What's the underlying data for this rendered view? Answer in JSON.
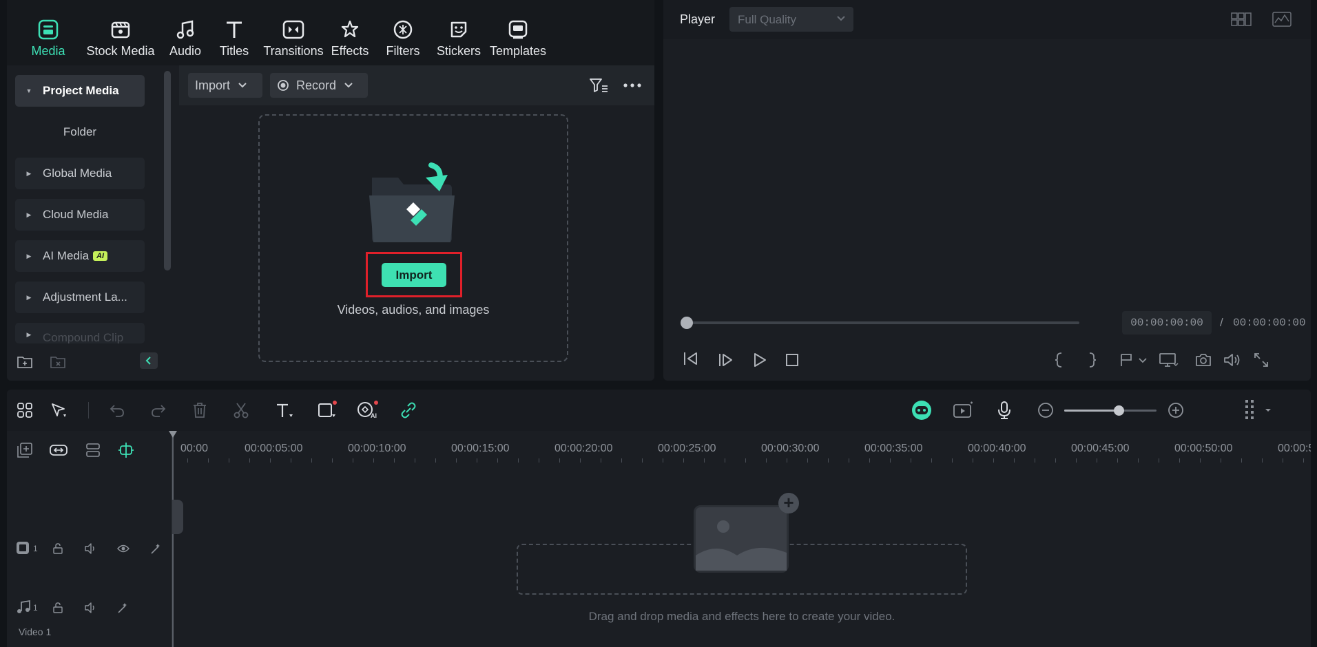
{
  "nav": {
    "items": [
      {
        "label": "Media",
        "icon": "media-icon",
        "active": true
      },
      {
        "label": "Stock Media",
        "icon": "stock-media-icon"
      },
      {
        "label": "Audio",
        "icon": "music-note-icon"
      },
      {
        "label": "Titles",
        "icon": "titles-t-icon"
      },
      {
        "label": "Transitions",
        "icon": "transitions-icon"
      },
      {
        "label": "Effects",
        "icon": "effects-icon"
      },
      {
        "label": "Filters",
        "icon": "filters-icon"
      },
      {
        "label": "Stickers",
        "icon": "stickers-icon"
      },
      {
        "label": "Templates",
        "icon": "templates-icon"
      }
    ]
  },
  "sidebar": {
    "project_media": "Project Media",
    "folder": "Folder",
    "global_media": "Global Media",
    "cloud_media": "Cloud Media",
    "ai_media": "AI Media",
    "ai_badge": "AI",
    "adjustment_layer": "Adjustment La...",
    "compound_clip": "Compound Clip"
  },
  "media_toolbar": {
    "import_label": "Import",
    "record_label": "Record"
  },
  "dropzone": {
    "import_button": "Import",
    "caption": "Videos, audios, and images"
  },
  "player": {
    "title": "Player",
    "quality": "Full Quality",
    "current_time": "00:00:00:00",
    "separator": "/",
    "total_time": "00:00:00:00"
  },
  "timeline": {
    "ruler": [
      "00:00",
      "00:00:05:00",
      "00:00:10:00",
      "00:00:15:00",
      "00:00:20:00",
      "00:00:25:00",
      "00:00:30:00",
      "00:00:35:00",
      "00:00:40:00",
      "00:00:45:00",
      "00:00:50:00",
      "00:00:5"
    ],
    "track_video_label": "Video 1",
    "track_video_num": "1",
    "track_audio_num": "1",
    "drop_text": "Drag and drop media and effects here to create your video."
  },
  "colors": {
    "accent": "#3de0b5",
    "highlight": "#e0202a",
    "ai_badge": "#c5f05a"
  }
}
